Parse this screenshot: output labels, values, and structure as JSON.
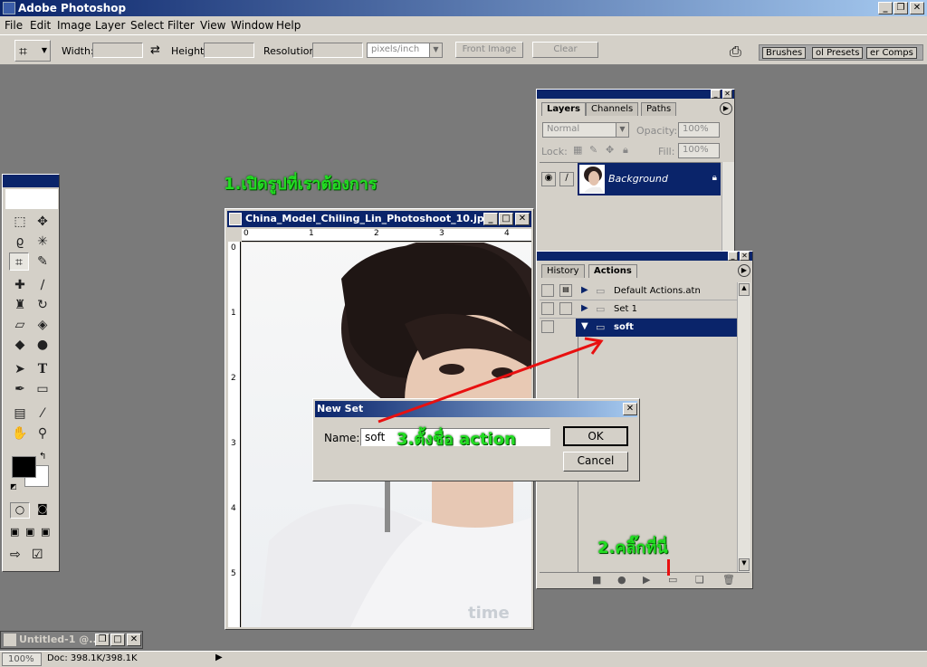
{
  "app": {
    "title": "Adobe Photoshop"
  },
  "menu": [
    "File",
    "Edit",
    "Image",
    "Layer",
    "Select",
    "Filter",
    "View",
    "Window",
    "Help"
  ],
  "options": {
    "width_label": "Width:",
    "height_label": "Height:",
    "resolution_label": "Resolution:",
    "units": "pixels/inch",
    "front_image": "Front Image",
    "clear": "Clear"
  },
  "well_tabs": [
    "Brushes",
    "ol Presets",
    "er Comps"
  ],
  "document": {
    "title": "China_Model_Chiling_Lin_Photoshoot_10.jp...",
    "ruler_top": [
      "0",
      "1",
      "2",
      "3",
      "4"
    ],
    "ruler_left": [
      "0",
      "1",
      "2",
      "3",
      "4",
      "5"
    ],
    "watermark": "time"
  },
  "layers_palette": {
    "tabs": [
      "Layers",
      "Channels",
      "Paths"
    ],
    "blend_mode": "Normal",
    "opacity_label": "Opacity:",
    "opacity_value": "100%",
    "lock_label": "Lock:",
    "fill_label": "Fill:",
    "fill_value": "100%",
    "layer_name": "Background"
  },
  "actions_palette": {
    "tabs": [
      "History",
      "Actions"
    ],
    "items": [
      "Default Actions.atn",
      "Set 1",
      "soft"
    ]
  },
  "dialog": {
    "title": "New Set",
    "name_label": "Name:",
    "name_value": "soft",
    "ok": "OK",
    "cancel": "Cancel"
  },
  "annotations": {
    "step1": "1.เปิดรูปที่เราต้องการ",
    "step2": "2.คลิ๊กที่นี่",
    "step3": "3.ตั้งชื่อ action"
  },
  "minimized": {
    "title": "Untitled-1 @..."
  },
  "status": {
    "zoom": "100%",
    "doc": "Doc: 398.1K/398.1K"
  },
  "colors": {
    "accent": "#0a246a",
    "annotation": "#22dd22",
    "arrow": "#e81010"
  }
}
